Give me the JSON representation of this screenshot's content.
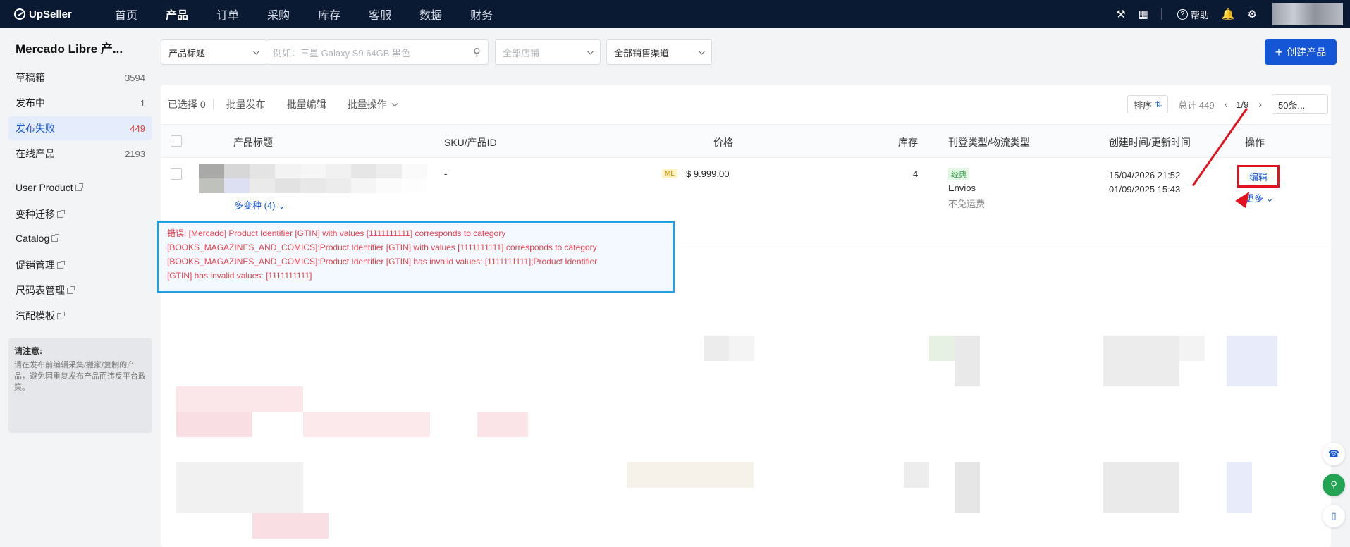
{
  "app": {
    "logo": "UpSeller"
  },
  "nav": [
    "首页",
    "产品",
    "订单",
    "采购",
    "库存",
    "客服",
    "数据",
    "财务"
  ],
  "top_right": {
    "help_label": "帮助"
  },
  "sidebar": {
    "title": "Mercado Libre 产...",
    "items": [
      {
        "label": "草稿箱",
        "count": "3594"
      },
      {
        "label": "发布中",
        "count": "1"
      },
      {
        "label": "发布失败",
        "count": "449"
      },
      {
        "label": "在线产品",
        "count": "2193"
      }
    ],
    "links": [
      "User Product",
      "变种迁移",
      "Catalog",
      "促销管理",
      "尺码表管理",
      "汽配模板"
    ],
    "notice_title": "请注意:",
    "notice_body": "请在发布前编辑采集/搬家/复制的产品，避免因重复发布产品而违反平台政策。"
  },
  "filters": {
    "field_select": "产品标题",
    "search_placeholder": "例如：三星 Galaxy S9 64GB 黑色",
    "store_select": "全部店铺",
    "channel_select": "全部销售渠道"
  },
  "create_button": "创建产品",
  "toolbar": {
    "selected": "已选择 0",
    "batch_publish": "批量发布",
    "batch_edit": "批量编辑",
    "batch_ops": "批量操作",
    "sort": "排序",
    "total": "总计 449",
    "page": "1/9",
    "page_size": "50条..."
  },
  "table": {
    "headers": [
      "产品标题",
      "SKU/产品ID",
      "价格",
      "库存",
      "刊登类型/物流类型",
      "创建时间/更新时间",
      "操作"
    ],
    "row": {
      "variants": "多变种 (4)",
      "sku": "-",
      "platform_badge": "ML",
      "price": "$ 9.999,00",
      "stock": "4",
      "listing_type": "经典",
      "shipping": "Envios",
      "shipping_fee": "不免运费",
      "created": "15/04/2026 21:52",
      "updated": "01/09/2025 15:43",
      "edit": "编辑",
      "more": "更多"
    }
  },
  "error": {
    "lines": [
      "错误: [Mercado] Product Identifier [GTIN] with values [1111111111] corresponds to category",
      "[BOOKS_MAGAZINES_AND_COMICS]:Product Identifier [GTIN] with values [1111111111] corresponds to category",
      "[BOOKS_MAGAZINES_AND_COMICS]:Product Identifier [GTIN] has invalid values: [1111111111];Product Identifier",
      "[GTIN] has invalid values: [1111111111]"
    ]
  },
  "colors": {
    "primary": "#1556d7",
    "nav_bg": "#0b1a33",
    "error": "#e8414d",
    "highlight": "#e3101d",
    "callout_border": "#1ea0e3"
  },
  "icons": [
    "logo-icon",
    "search-icon",
    "wrench-icon",
    "apps-icon",
    "help-icon",
    "bell-icon",
    "gear-icon",
    "sort-icon",
    "chevron-left-icon",
    "chevron-right-icon",
    "plus-icon",
    "headset-icon",
    "chat-icon",
    "phone-icon"
  ]
}
